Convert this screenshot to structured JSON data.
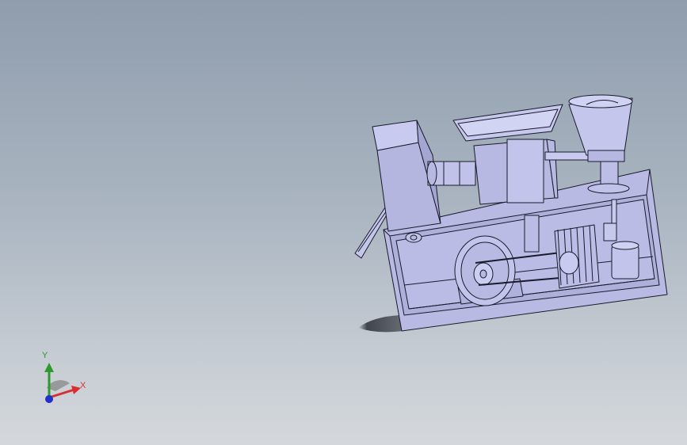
{
  "viewport": {
    "background_top": "#8f9dad",
    "background_bottom": "#d4d8dc",
    "model_fill": "#b7b9e3",
    "model_edge": "#1a1a2a"
  },
  "triad": {
    "x_label": "X",
    "y_label": "Y",
    "x_color": "#d83030",
    "y_color": "#2c9a2c",
    "z_color": "#2030c8"
  }
}
